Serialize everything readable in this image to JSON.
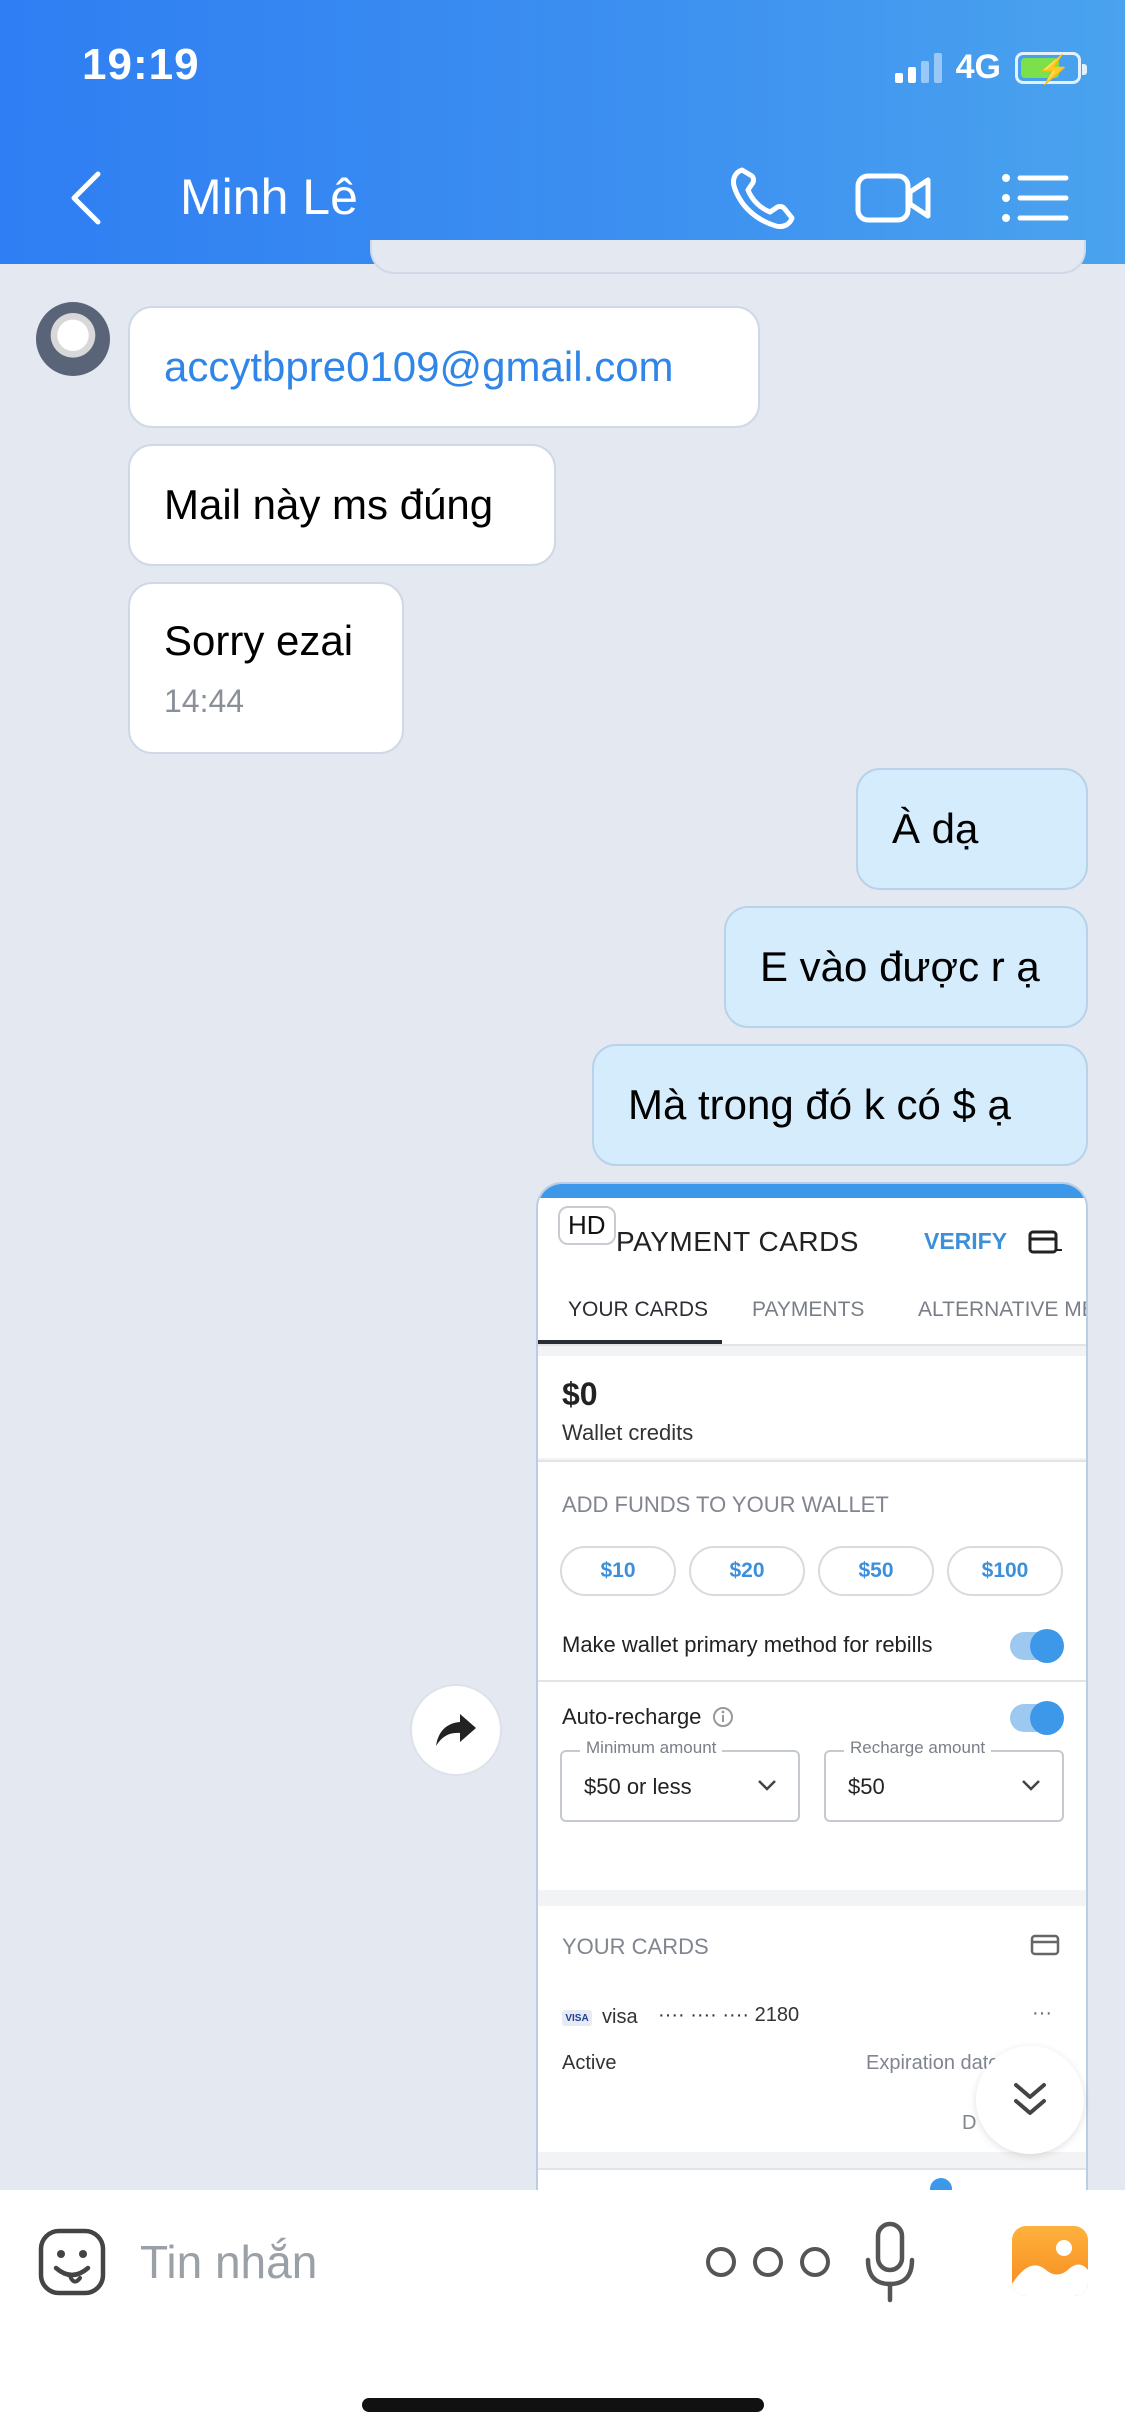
{
  "status_bar": {
    "time": "19:19",
    "network": "4G"
  },
  "header": {
    "title": "Minh Lê"
  },
  "messages": {
    "incoming": [
      {
        "text": "accytbpre0109@gmail.com"
      },
      {
        "text": "Mail này ms đúng"
      },
      {
        "text": "Sorry ezai",
        "time": "14:44"
      }
    ],
    "outgoing": [
      {
        "text": "À dạ"
      },
      {
        "text": "E vào được r ạ"
      },
      {
        "text": "Mà trong đó k có $ ạ"
      }
    ]
  },
  "image_message": {
    "hd_badge": "HD",
    "screen_title": "PAYMENT CARDS",
    "verify": "VERIFY",
    "tabs": [
      "YOUR CARDS",
      "PAYMENTS",
      "ALTERNATIVE MET"
    ],
    "wallet_amount": "$0",
    "wallet_label": "Wallet credits",
    "add_funds_label": "ADD FUNDS TO YOUR WALLET",
    "amounts": [
      "$10",
      "$20",
      "$50",
      "$100"
    ],
    "primary_method_label": "Make wallet primary method for rebills",
    "auto_recharge_label": "Auto-recharge",
    "min_amount_label": "Minimum amount",
    "min_amount_value": "$50 or less",
    "recharge_amount_label": "Recharge amount",
    "recharge_amount_value": "$50",
    "your_cards_label": "YOUR CARDS",
    "card_brand": "visa",
    "card_number": "···· ···· ···· 2180",
    "card_status": "Active",
    "card_expiry": "Expiration date 10/25",
    "partial_text": "D"
  },
  "composer": {
    "placeholder": "Tin nhắn"
  },
  "colors": {
    "header_start": "#2f7ef3",
    "header_end": "#4aa3ee",
    "outgoing_bubble": "#d4ecfc",
    "link": "#2f86e8",
    "photo_button": "#f58b1f"
  }
}
